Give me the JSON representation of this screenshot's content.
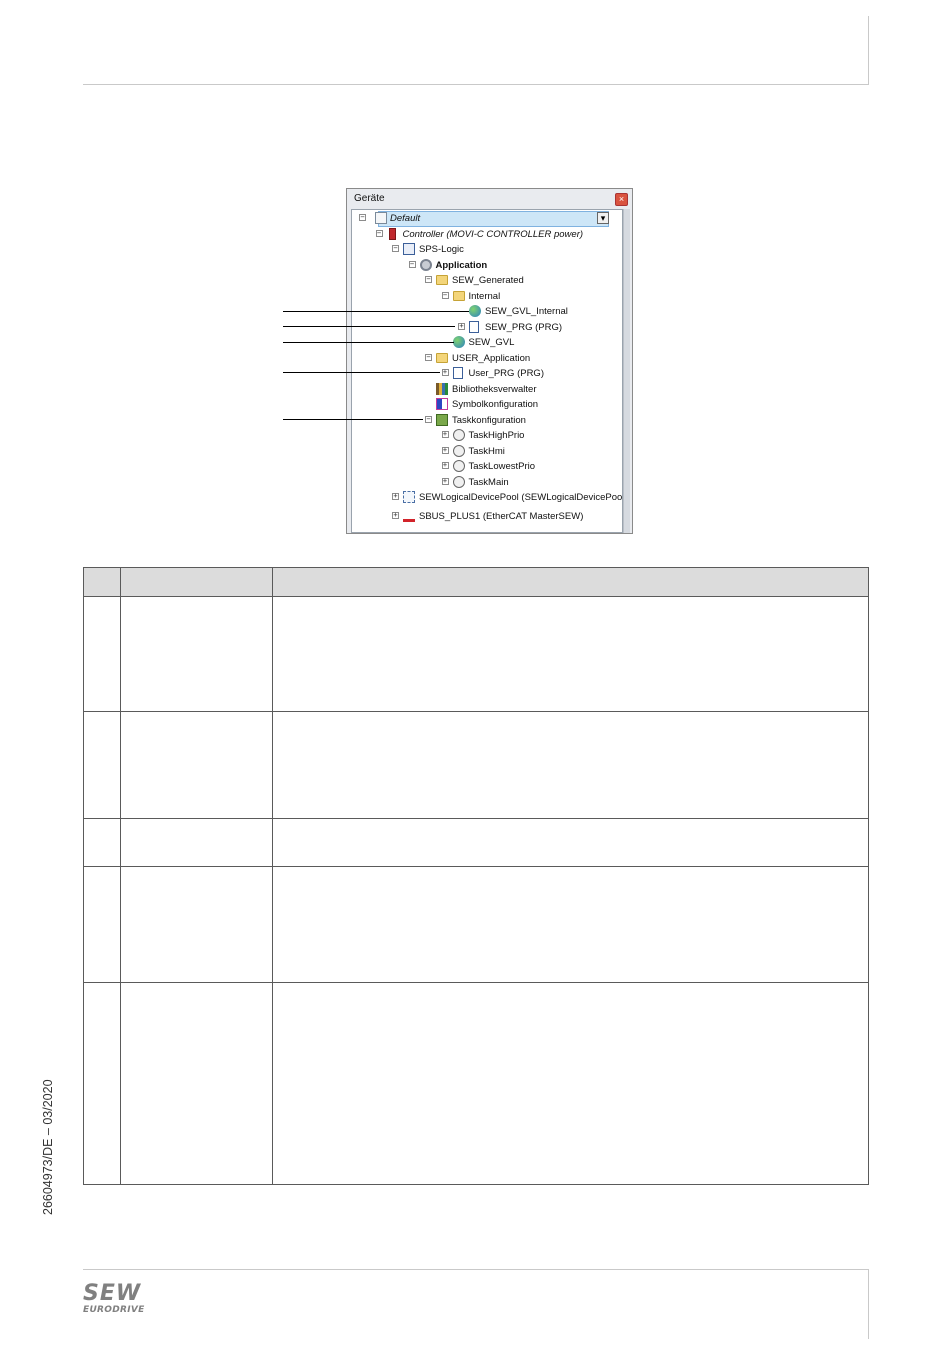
{
  "panel": {
    "title": "Geräte",
    "close_glyph": "×",
    "dropdown_glyph": "▾",
    "tree": [
      {
        "label": "Default",
        "icon": "project-icon",
        "expander": "−",
        "selected": true,
        "italic": true
      },
      {
        "label": "Controller (MOVI-C CONTROLLER power)",
        "icon": "controller-icon",
        "expander": "−",
        "italic": true
      },
      {
        "label": "SPS-Logic",
        "icon": "plc-logic-icon",
        "expander": "−"
      },
      {
        "label": "Application",
        "icon": "gear-icon",
        "expander": "−",
        "bold": true
      },
      {
        "label": "SEW_Generated",
        "icon": "folder-icon",
        "expander": "−"
      },
      {
        "label": "Internal",
        "icon": "folder-icon",
        "expander": "−"
      },
      {
        "label": "SEW_GVL_Internal",
        "icon": "globe-icon",
        "expander": ""
      },
      {
        "label": "SEW_PRG (PRG)",
        "icon": "program-icon",
        "expander": "+"
      },
      {
        "label": "SEW_GVL",
        "icon": "globe-icon",
        "expander": ""
      },
      {
        "label": "USER_Application",
        "icon": "folder-icon",
        "expander": "−"
      },
      {
        "label": "User_PRG (PRG)",
        "icon": "program-icon",
        "expander": "+"
      },
      {
        "label": "Bibliotheksverwalter",
        "icon": "library-icon",
        "expander": ""
      },
      {
        "label": "Symbolkonfiguration",
        "icon": "symbol-config-icon",
        "expander": ""
      },
      {
        "label": "Taskkonfiguration",
        "icon": "task-config-icon",
        "expander": "−"
      },
      {
        "label": "TaskHighPrio",
        "icon": "task-icon",
        "expander": "+"
      },
      {
        "label": "TaskHmi",
        "icon": "task-icon",
        "expander": "+"
      },
      {
        "label": "TaskLowestPrio",
        "icon": "task-icon",
        "expander": "+"
      },
      {
        "label": "TaskMain",
        "icon": "task-icon",
        "expander": "+"
      },
      {
        "label": "SEWLogicalDevicePool (SEWLogicalDevicePool)",
        "icon": "device-pool-icon",
        "expander": "+"
      },
      {
        "label": "SBUS_PLUS1 (EtherCAT MasterSEW)",
        "icon": "ethercat-icon",
        "expander": "+"
      }
    ]
  },
  "footer": {
    "doc_id": "26604973/DE – 03/2020",
    "logo_main": "SEW",
    "logo_sub": "EURODRIVE"
  },
  "colors": {
    "selection": "#cde6f7",
    "table_header": "#dcdcdc",
    "logo": "#808080"
  }
}
